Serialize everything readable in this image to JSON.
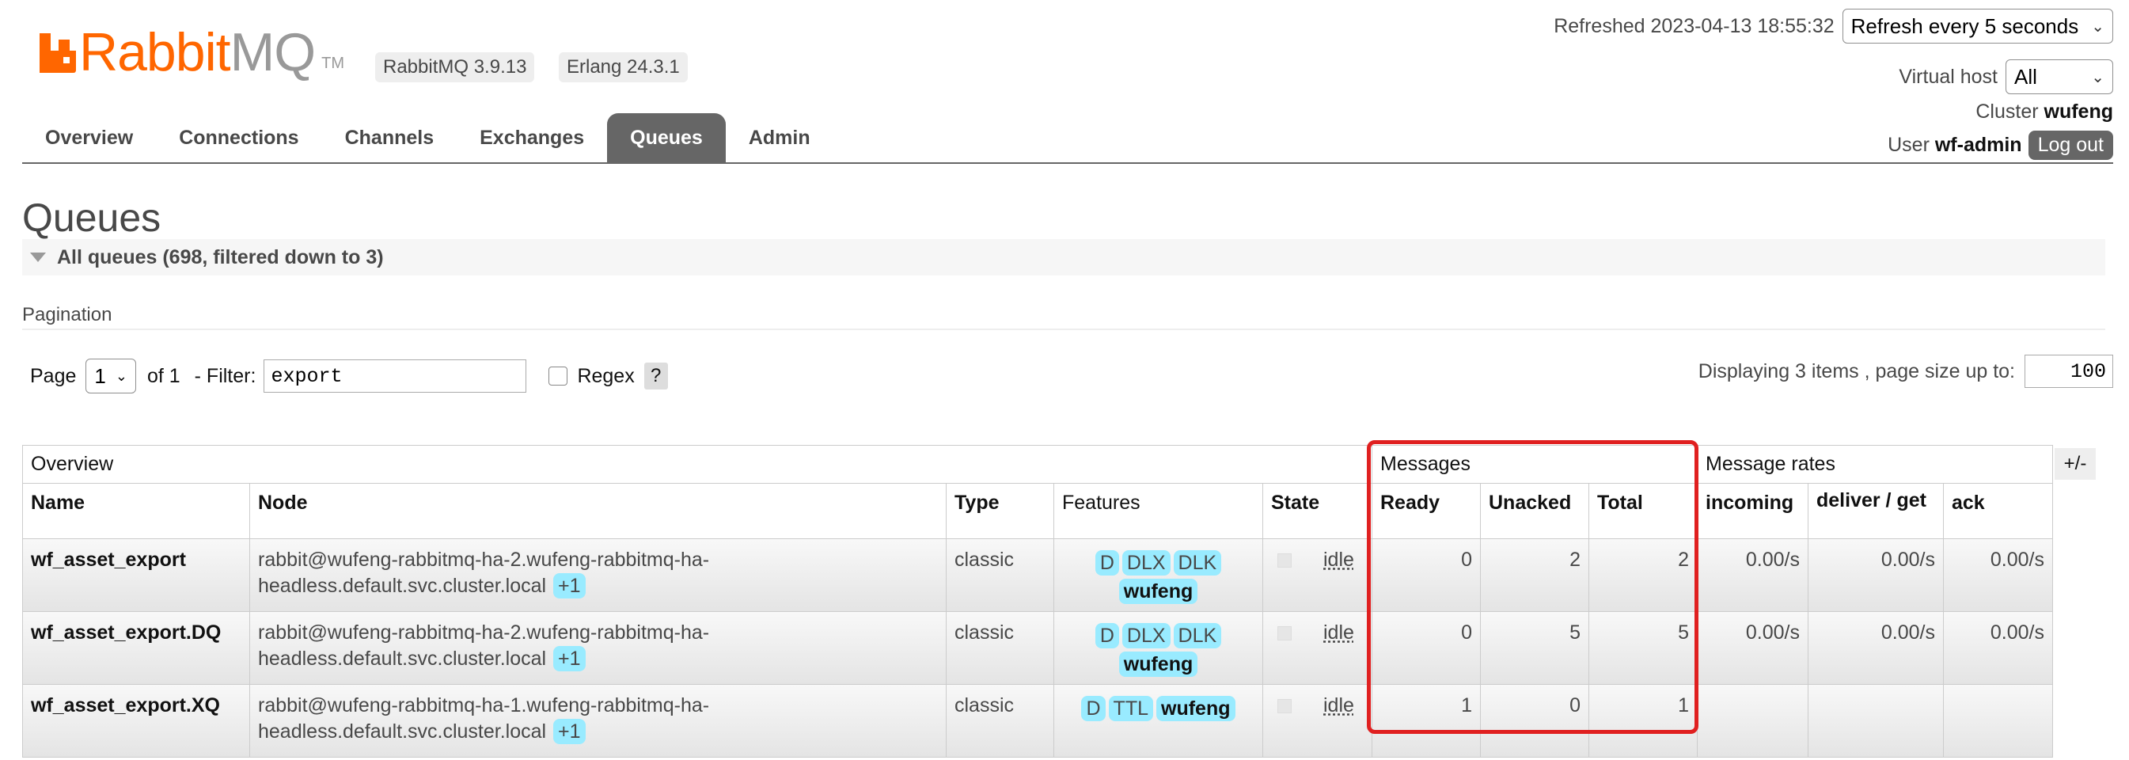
{
  "brand": {
    "name_part1": "Rabbit",
    "name_part2": "MQ",
    "tm": "TM"
  },
  "versions": [
    "RabbitMQ 3.9.13",
    "Erlang 24.3.1"
  ],
  "header": {
    "refreshed": "Refreshed 2023-04-13 18:55:32",
    "refresh_select": "Refresh every 5 seconds",
    "vhost_label": "Virtual host",
    "vhost_value": "All",
    "cluster_label": "Cluster",
    "cluster_value": "wufeng",
    "user_label": "User",
    "user_value": "wf-admin",
    "logout": "Log out"
  },
  "tabs": [
    "Overview",
    "Connections",
    "Channels",
    "Exchanges",
    "Queues",
    "Admin"
  ],
  "active_tab": "Queues",
  "page_title": "Queues",
  "section_title": "All queues (698, filtered down to 3)",
  "pagination": {
    "label": "Pagination",
    "page_label": "Page",
    "page_value": "1",
    "of_text": "of 1",
    "filter_label": "- Filter:",
    "filter_value": "export",
    "regex_label": "Regex",
    "help": "?",
    "display_text": "Displaying 3 items , page size up to:",
    "page_size": "100"
  },
  "table": {
    "groups": {
      "overview": "Overview",
      "messages": "Messages",
      "rates": "Message rates",
      "toggle": "+/-"
    },
    "columns": {
      "name": "Name",
      "node": "Node",
      "type": "Type",
      "features": "Features",
      "state": "State",
      "ready": "Ready",
      "unacked": "Unacked",
      "total": "Total",
      "incoming": "incoming",
      "deliver_get": "deliver / get",
      "ack": "ack"
    },
    "rows": [
      {
        "name": "wf_asset_export",
        "node_line1": "rabbit@wufeng-rabbitmq-ha-2.wufeng-rabbitmq-ha-",
        "node_line2": "headless.default.svc.cluster.local",
        "node_extra": "+1",
        "type": "classic",
        "features": [
          "D",
          "DLX",
          "DLK"
        ],
        "policy": "wufeng",
        "state": "idle",
        "ready": "0",
        "unacked": "2",
        "total": "2",
        "incoming": "0.00/s",
        "deliver_get": "0.00/s",
        "ack": "0.00/s"
      },
      {
        "name": "wf_asset_export.DQ",
        "node_line1": "rabbit@wufeng-rabbitmq-ha-2.wufeng-rabbitmq-ha-",
        "node_line2": "headless.default.svc.cluster.local",
        "node_extra": "+1",
        "type": "classic",
        "features": [
          "D",
          "DLX",
          "DLK"
        ],
        "policy": "wufeng",
        "state": "idle",
        "ready": "0",
        "unacked": "5",
        "total": "5",
        "incoming": "0.00/s",
        "deliver_get": "0.00/s",
        "ack": "0.00/s"
      },
      {
        "name": "wf_asset_export.XQ",
        "node_line1": "rabbit@wufeng-rabbitmq-ha-1.wufeng-rabbitmq-ha-",
        "node_line2": "headless.default.svc.cluster.local",
        "node_extra": "+1",
        "type": "classic",
        "features": [
          "D",
          "TTL"
        ],
        "policy": "wufeng",
        "state": "idle",
        "ready": "1",
        "unacked": "0",
        "total": "1",
        "incoming": "",
        "deliver_get": "",
        "ack": ""
      }
    ]
  },
  "colors": {
    "brand_orange": "#ff6600",
    "pill_blue": "#99ebff",
    "highlight_red": "#e02020",
    "tab_active": "#666666"
  }
}
